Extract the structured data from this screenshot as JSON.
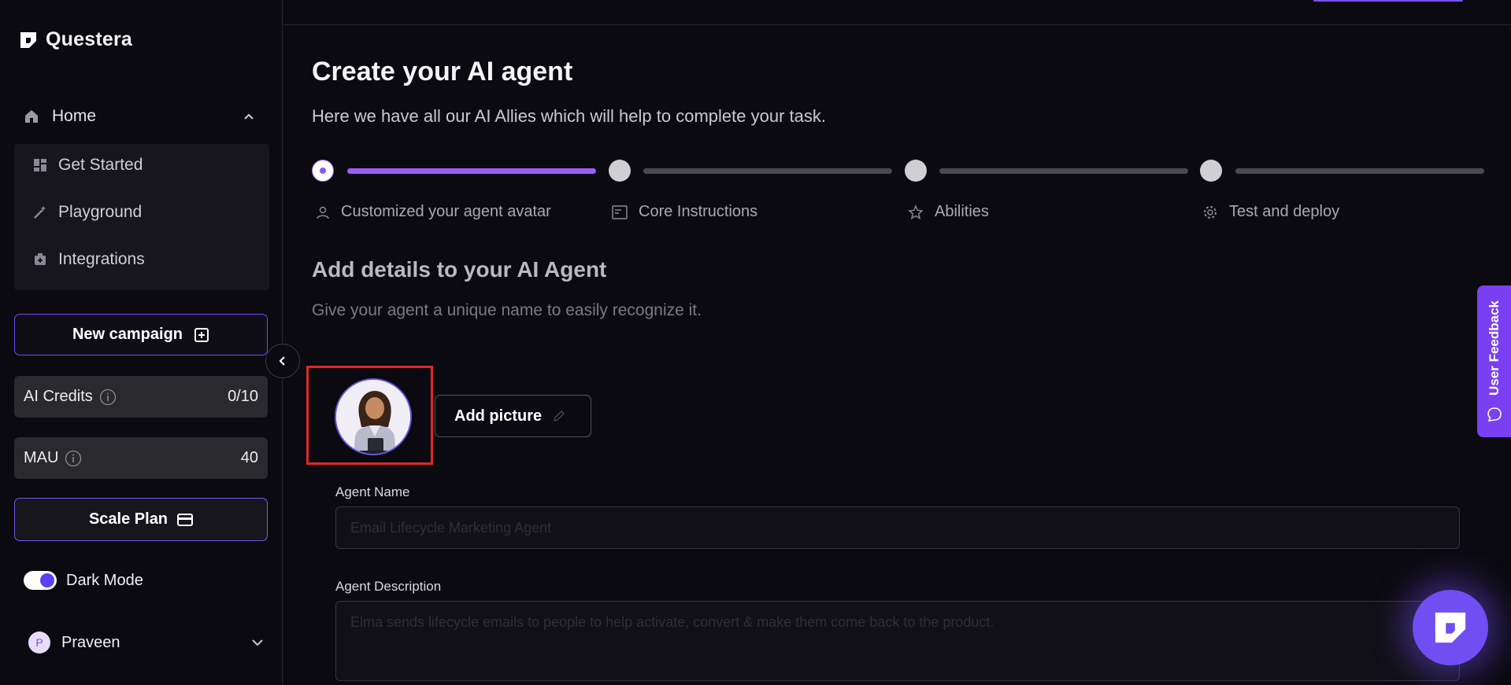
{
  "brand": {
    "name": "Questera"
  },
  "sidebar": {
    "home_label": "Home",
    "items": [
      {
        "label": "Get Started",
        "icon": "grid-icon"
      },
      {
        "label": "Playground",
        "icon": "magic-wand-icon"
      },
      {
        "label": "Integrations",
        "icon": "plug-icon"
      }
    ],
    "new_campaign_label": "New campaign",
    "ai_credits": {
      "label": "AI Credits",
      "value": "0/10"
    },
    "mau": {
      "label": "MAU",
      "value": "40"
    },
    "scale_plan_label": "Scale Plan",
    "dark_mode": {
      "label": "Dark Mode",
      "on": true
    },
    "user": {
      "initial": "P",
      "name": "Praveen"
    }
  },
  "main": {
    "title": "Create your AI agent",
    "subtitle": "Here we have all our AI Allies which will help to complete your task.",
    "steps": [
      {
        "label": "Customized your agent avatar",
        "icon": "person-icon",
        "active": true
      },
      {
        "label": "Core Instructions",
        "icon": "document-icon",
        "active": false
      },
      {
        "label": "Abilities",
        "icon": "star-icon",
        "active": false
      },
      {
        "label": "Test and deploy",
        "icon": "gear-icon",
        "active": false
      }
    ],
    "section_title": "Add details to your AI Agent",
    "section_subtitle": "Give your agent a unique name to easily recognize it.",
    "add_picture_label": "Add picture",
    "agent_name": {
      "label": "Agent Name",
      "placeholder": "Email Lifecycle Marketing Agent"
    },
    "agent_description": {
      "label": "Agent Description",
      "placeholder": "Elma sends lifecycle emails to people to help activate, convert & make them come back to the product."
    }
  },
  "feedback": {
    "label": "User Feedback"
  },
  "colors": {
    "accent": "#7b4ff0",
    "background": "#0b0a10",
    "highlight": "#e0262a"
  }
}
